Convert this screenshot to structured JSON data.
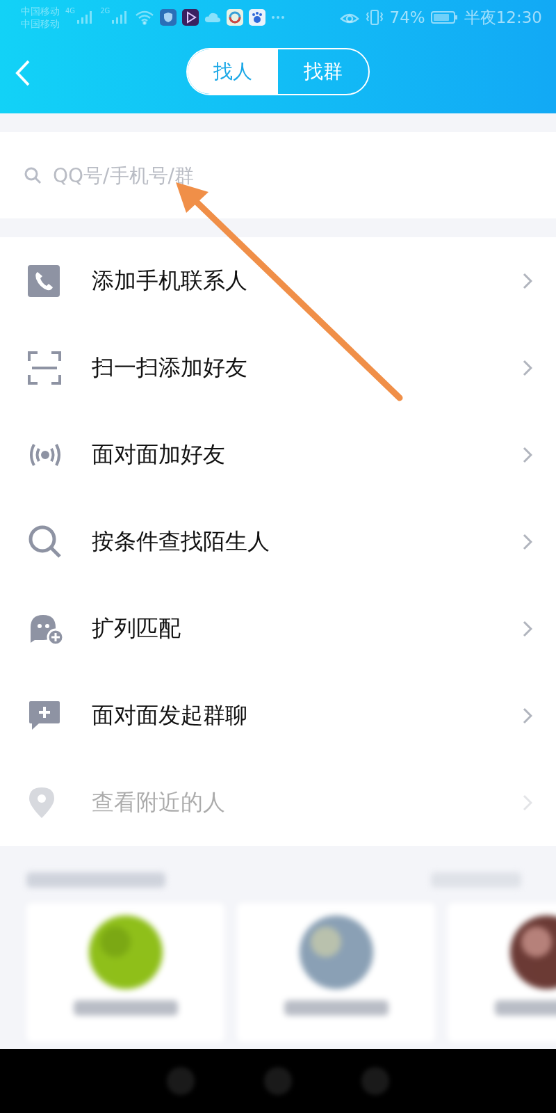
{
  "status_bar": {
    "carriers": [
      "中国移动",
      "中国移动"
    ],
    "networks": [
      "4G",
      "2G"
    ],
    "battery_percent": "74%",
    "time": "半夜12:30"
  },
  "header": {
    "tabs": [
      {
        "label": "找人",
        "selected": true
      },
      {
        "label": "找群",
        "selected": false
      }
    ]
  },
  "search": {
    "placeholder": "QQ号/手机号/群"
  },
  "menu": [
    {
      "kind": "phone",
      "label": "添加手机联系人",
      "dimmed": false
    },
    {
      "kind": "scan",
      "label": "扫一扫添加好友",
      "dimmed": false
    },
    {
      "kind": "broadcast",
      "label": "面对面加好友",
      "dimmed": false
    },
    {
      "kind": "search",
      "label": "按条件查找陌生人",
      "dimmed": false
    },
    {
      "kind": "match",
      "label": "扩列匹配",
      "dimmed": false
    },
    {
      "kind": "chat",
      "label": "面对面发起群聊",
      "dimmed": false
    },
    {
      "kind": "location",
      "label": "查看附近的人",
      "dimmed": true
    }
  ]
}
